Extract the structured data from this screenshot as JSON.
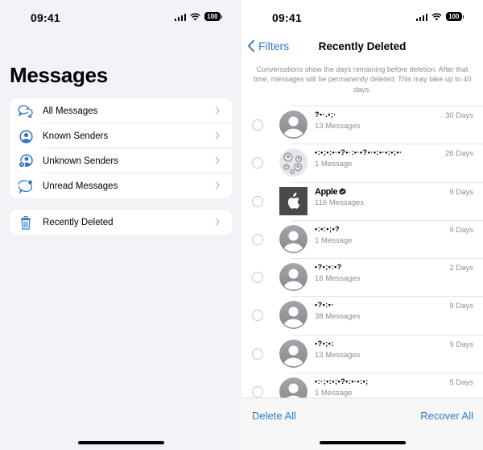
{
  "left_screen": {
    "status_bar": {
      "time": "09:41",
      "battery": "100",
      "icons": [
        "cellular-signal-icon",
        "wifi-icon",
        "battery-icon"
      ]
    },
    "title": "Messages",
    "filters": [
      {
        "label": "All Messages",
        "icon": "chat-bubbles-icon"
      },
      {
        "label": "Known Senders",
        "icon": "person-circle-icon"
      },
      {
        "label": "Unknown Senders",
        "icon": "person-question-icon"
      },
      {
        "label": "Unread Messages",
        "icon": "unread-bubble-icon"
      }
    ],
    "recently_deleted": {
      "label": "Recently Deleted",
      "icon": "trash-icon"
    }
  },
  "right_screen": {
    "status_bar": {
      "time": "09:41",
      "battery": "100"
    },
    "nav": {
      "back_label": "Filters",
      "title": "Recently Deleted"
    },
    "info": "Conversations show the days remaining before deletion. After that time, messages will be permanently deleted. This may take up to 40 days.",
    "conversations": [
      {
        "name": "?•·.•;·",
        "redacted": true,
        "count": "13 Messages",
        "days": "30 Days",
        "avatar": "person"
      },
      {
        "name": "•:•;•:•·•?•·:•·•?•·•:•·•:•;•·",
        "redacted": true,
        "count": "1 Message",
        "days": "26 Days",
        "avatar": "group"
      },
      {
        "name": "Apple",
        "redacted": false,
        "verified": true,
        "count": "116 Messages",
        "days": "9 Days",
        "avatar": "apple"
      },
      {
        "name": "•:•:•;•?",
        "redacted": true,
        "count": "1 Message",
        "days": "9 Days",
        "avatar": "person"
      },
      {
        "name": "•?•;•:•?",
        "redacted": true,
        "count": "16 Messages",
        "days": "2 Days",
        "avatar": "person"
      },
      {
        "name": "•?•:•·",
        "redacted": true,
        "count": "38 Messages",
        "days": "9 Days",
        "avatar": "person"
      },
      {
        "name": "•?•;•:",
        "redacted": true,
        "count": "13 Messages",
        "days": "9 Days",
        "avatar": "person"
      },
      {
        "name": "•:·;•:•;•?•:•·•:•;",
        "redacted": true,
        "count": "1 Message",
        "days": "5 Days",
        "avatar": "person"
      }
    ],
    "toolbar": {
      "delete_all": "Delete All",
      "recover_all": "Recover All"
    }
  },
  "colors": {
    "accent": "#3478c6",
    "secondary_text": "#8e8e93",
    "grouped_bg": "#f2f2f7",
    "separator": "#e5e5ea"
  }
}
